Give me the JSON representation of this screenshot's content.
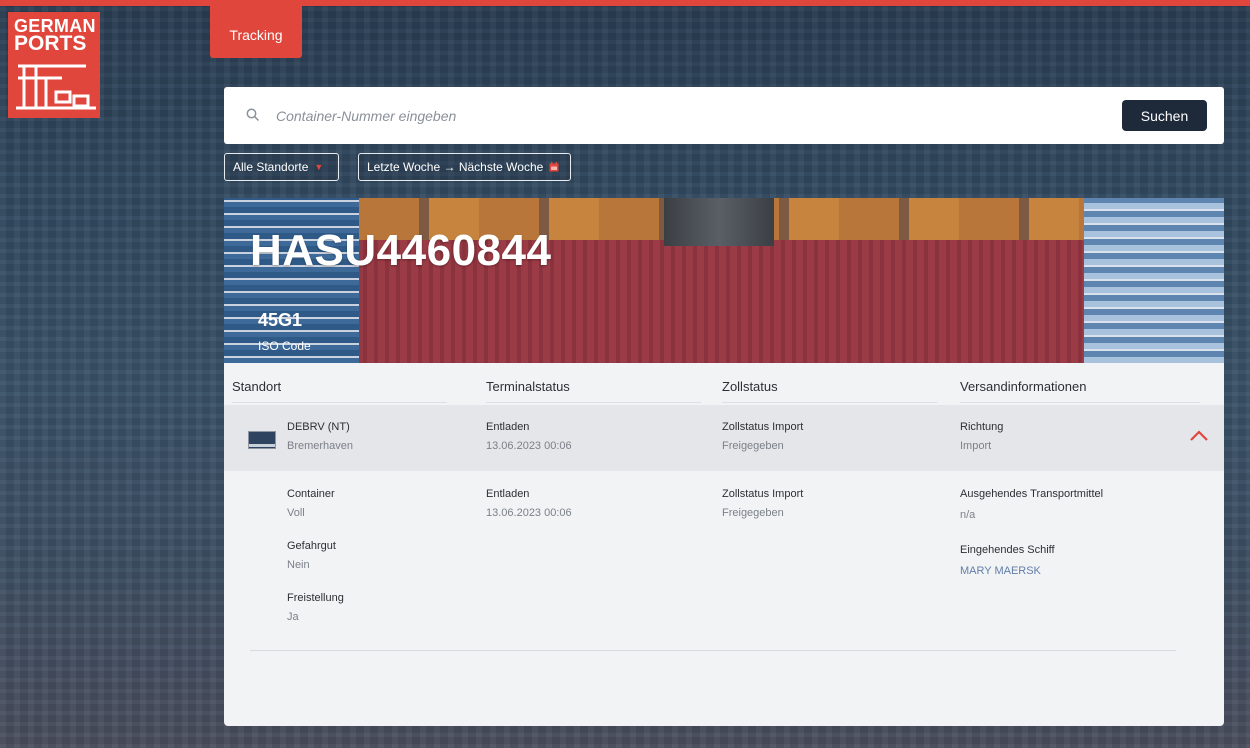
{
  "logo": {
    "line1": "GERMAN",
    "line2": "PORTS"
  },
  "nav": {
    "tab_label": "Tracking"
  },
  "search": {
    "placeholder": "Container-Nummer eingeben",
    "button_label": "Suchen"
  },
  "filters": {
    "location_label": "Alle Standorte",
    "date_range_label": "Letzte Woche → Nächste Woche"
  },
  "container": {
    "number": "HASU4460844",
    "iso_code": "45G1",
    "iso_label": "ISO Code"
  },
  "table": {
    "headers": [
      "Standort",
      "Terminalstatus",
      "Zollstatus",
      "Versandinformationen"
    ],
    "row": {
      "location_code": "DEBRV (NT)",
      "location_name": "Bremerhaven",
      "terminal_title": "Entladen",
      "terminal_date": "13.06.2023 00:06",
      "customs_title": "Zollstatus Import",
      "customs_value": "Freigegeben",
      "shipping_title": "Richtung",
      "shipping_value": "Import"
    }
  },
  "details": {
    "container_label": "Container",
    "container_value": "Voll",
    "hazard_label": "Gefahrgut",
    "hazard_value": "Nein",
    "release_label": "Freistellung",
    "release_value": "Ja",
    "terminal_title": "Entladen",
    "terminal_date": "13.06.2023 00:06",
    "customs_title": "Zollstatus Import",
    "customs_value": "Freigegeben",
    "outgoing_label": "Ausgehendes Transportmittel",
    "outgoing_value": "n/a",
    "incoming_label": "Eingehendes Schiff",
    "incoming_value": "MARY MAERSK"
  },
  "colors": {
    "accent": "#e0463c",
    "button_dark": "#1e2a3a",
    "link_blue": "#607ea8"
  }
}
